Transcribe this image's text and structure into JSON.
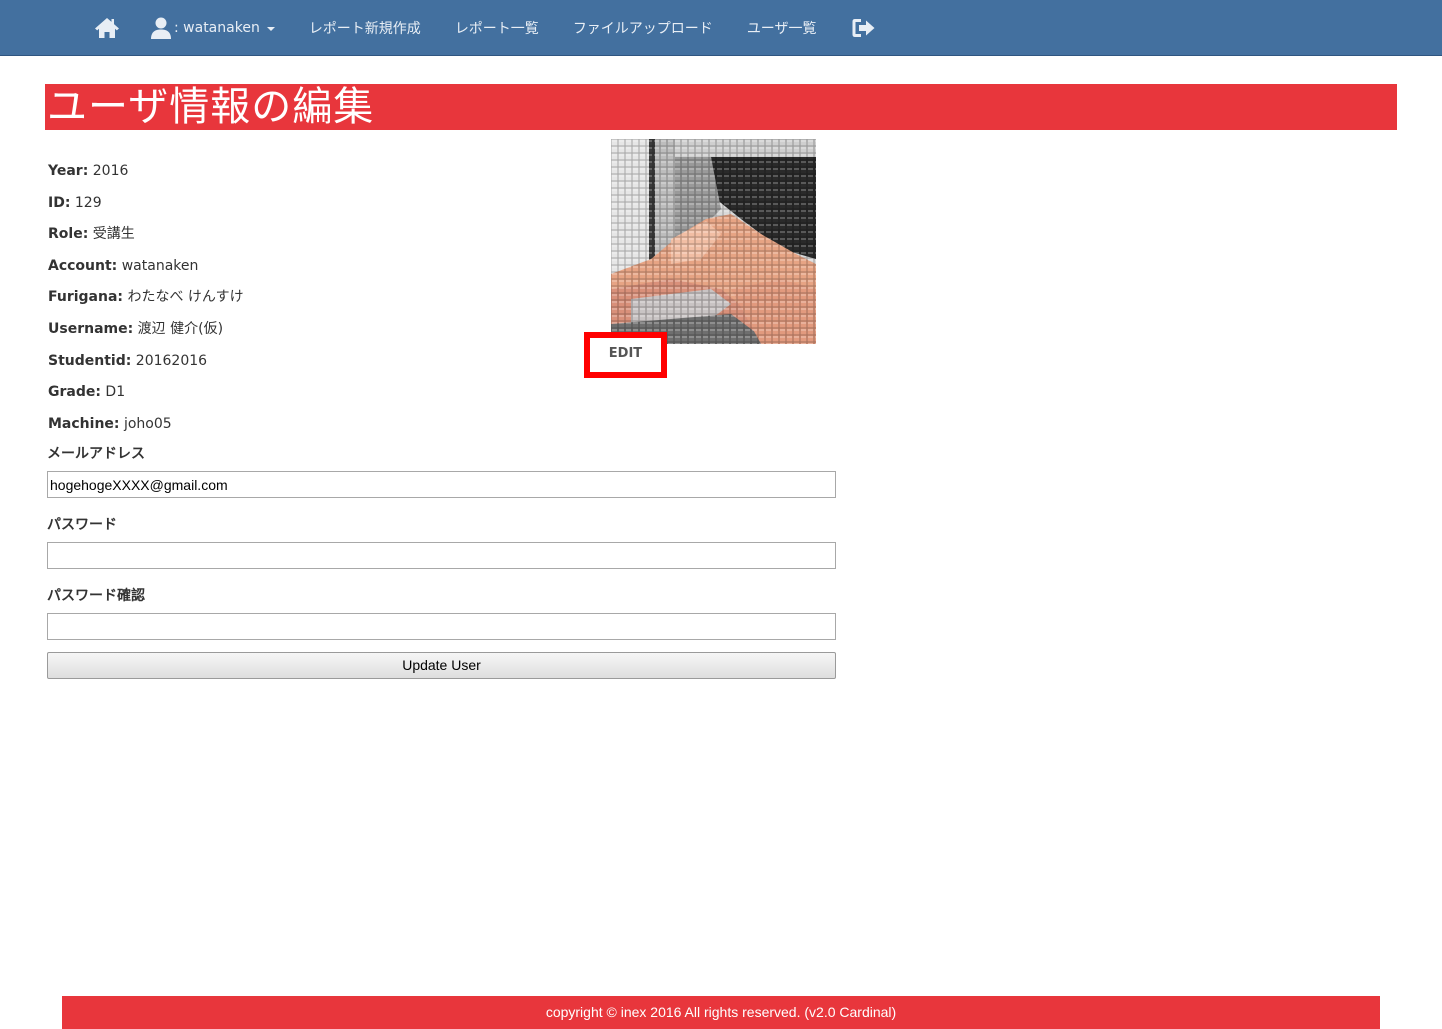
{
  "nav": {
    "username": ": watanaken",
    "links": [
      "レポート新規作成",
      "レポート一覧",
      "ファイルアップロード",
      "ユーザ一覧"
    ],
    "bg_color": "#43709f"
  },
  "page": {
    "title": "ユーザ情報の編集",
    "accent_color": "#e8363c"
  },
  "user": {
    "fields": [
      {
        "label": "Year:",
        "value": "2016"
      },
      {
        "label": "ID:",
        "value": "129"
      },
      {
        "label": "Role:",
        "value": "受講生"
      },
      {
        "label": "Account:",
        "value": "watanaken"
      },
      {
        "label": "Furigana:",
        "value": "わたなべ けんすけ"
      },
      {
        "label": "Username:",
        "value": "渡辺 健介(仮)"
      },
      {
        "label": "Studentid:",
        "value": "20162016"
      },
      {
        "label": "Grade:",
        "value": "D1"
      },
      {
        "label": "Machine:",
        "value": "joho05"
      }
    ],
    "avatar_edit_label": "EDIT"
  },
  "form": {
    "email_label": "メールアドレス",
    "email_value": "hogehogeXXXX@gmail.com",
    "password_label": "パスワード",
    "password_value": "",
    "password_confirm_label": "パスワード確認",
    "password_confirm_value": "",
    "submit_label": "Update User"
  },
  "footer": {
    "text": "copyright © inex 2016 All rights reserved. (v2.0 Cardinal)"
  },
  "icons": [
    "home-icon",
    "user-icon",
    "caret-down-icon",
    "sign-out-icon"
  ]
}
